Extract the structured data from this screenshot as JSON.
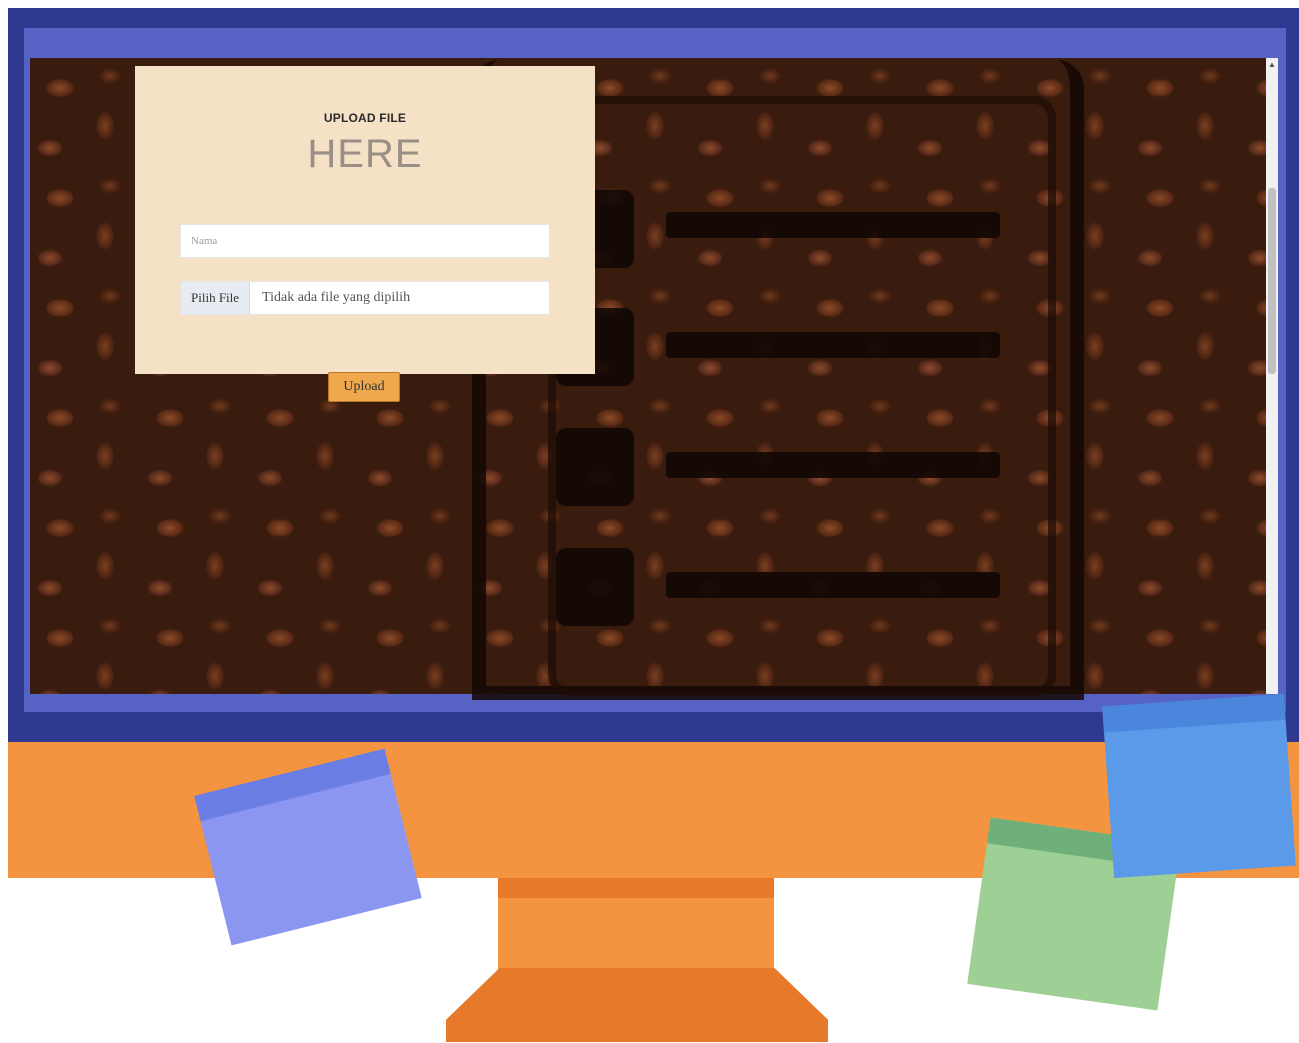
{
  "upload_form": {
    "title": "UPLOAD FILE",
    "subtitle": "HERE",
    "name_placeholder": "Nama",
    "file_button_label": "Pilih File",
    "file_status": "Tidak ada file yang dipilih",
    "submit_label": "Upload"
  },
  "colors": {
    "monitor_frame": "#2e3a8f",
    "screen_border": "#5662c4",
    "monitor_body": "#f59440",
    "stand_shadow": "#e67a2a",
    "panel_background": "#f5e1c6",
    "upload_button": "#f0a84c",
    "sticky_purple": "#8a96f0",
    "sticky_green": "#9ecf94",
    "sticky_blue": "#5b9ae8"
  },
  "icons": {
    "scroll_up": "triangle-up"
  }
}
